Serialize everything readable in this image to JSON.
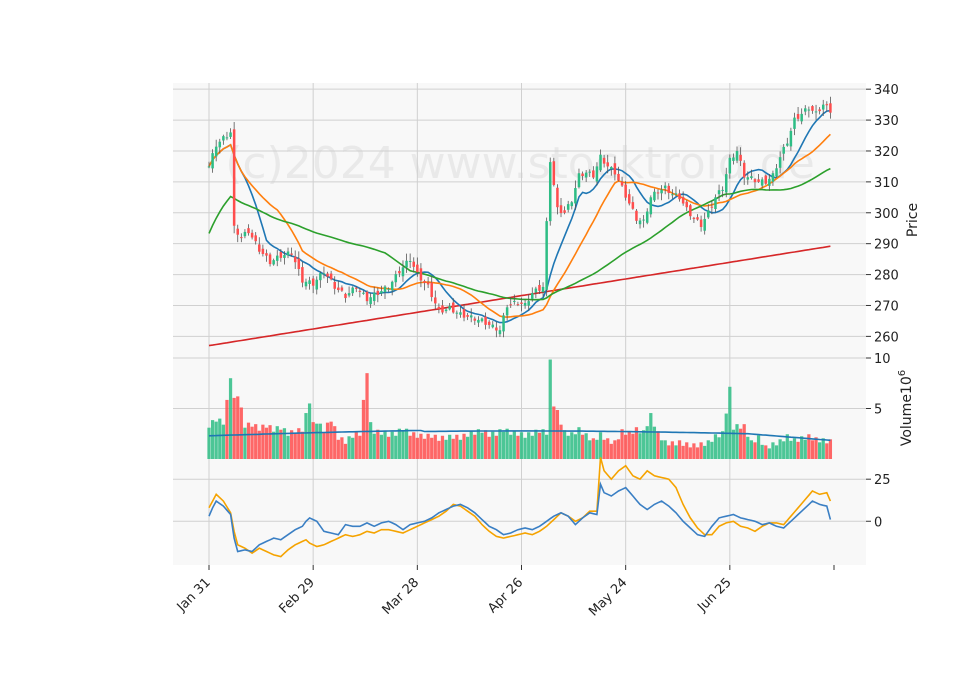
{
  "watermark": "(c)2024 www.stocktroid.de",
  "colors": {
    "up": "#2ebd85",
    "down": "#ff4d4d",
    "ma_short": "#1f77b4",
    "ma_mid": "#ff7f0e",
    "ma_long": "#2ca02c",
    "ma_200": "#d62728",
    "osc_a": "#3a7fc4",
    "osc_b": "#f5a300",
    "panel_bg": "#f8f8f8",
    "grid": "#d0d0d0"
  },
  "chart_data": [
    {
      "type": "candlestick",
      "panel": "price",
      "ylabel": "Price",
      "ylim": [
        253,
        342
      ],
      "yticks": [
        260,
        270,
        280,
        290,
        300,
        310,
        320,
        330,
        340
      ],
      "x_tick_labels": [
        "Jan 31",
        "Feb 29",
        "Mar 28",
        "Apr 26",
        "May 24",
        "Jun 25"
      ],
      "x_tick_index": [
        0,
        29,
        58,
        87,
        116,
        145
      ],
      "x_count": 174,
      "close_anchors": [
        [
          0,
          315
        ],
        [
          2,
          322
        ],
        [
          4,
          324
        ],
        [
          6,
          326
        ],
        [
          7,
          295
        ],
        [
          9,
          292
        ],
        [
          11,
          294
        ],
        [
          14,
          288
        ],
        [
          17,
          284
        ],
        [
          20,
          286
        ],
        [
          23,
          287
        ],
        [
          26,
          278
        ],
        [
          29,
          277
        ],
        [
          32,
          281
        ],
        [
          35,
          276
        ],
        [
          38,
          273
        ],
        [
          41,
          276
        ],
        [
          44,
          272
        ],
        [
          47,
          274
        ],
        [
          50,
          276
        ],
        [
          53,
          281
        ],
        [
          56,
          285
        ],
        [
          58,
          280
        ],
        [
          61,
          276
        ],
        [
          64,
          268
        ],
        [
          67,
          269
        ],
        [
          70,
          267
        ],
        [
          73,
          266
        ],
        [
          76,
          265
        ],
        [
          79,
          263
        ],
        [
          81,
          262
        ],
        [
          83,
          270
        ],
        [
          86,
          271
        ],
        [
          88,
          270
        ],
        [
          90,
          274
        ],
        [
          93,
          276
        ],
        [
          95,
          317
        ],
        [
          97,
          301
        ],
        [
          99,
          300
        ],
        [
          101,
          304
        ],
        [
          103,
          312
        ],
        [
          105,
          313
        ],
        [
          107,
          312
        ],
        [
          109,
          318
        ],
        [
          111,
          315
        ],
        [
          113,
          313
        ],
        [
          115,
          308
        ],
        [
          117,
          303
        ],
        [
          119,
          298
        ],
        [
          121,
          297
        ],
        [
          123,
          305
        ],
        [
          125,
          307
        ],
        [
          127,
          308
        ],
        [
          129,
          306
        ],
        [
          131,
          305
        ],
        [
          133,
          301
        ],
        [
          135,
          298
        ],
        [
          137,
          296
        ],
        [
          139,
          300
        ],
        [
          141,
          305
        ],
        [
          143,
          308
        ],
        [
          145,
          317
        ],
        [
          147,
          320
        ],
        [
          149,
          312
        ],
        [
          151,
          311
        ],
        [
          153,
          310
        ],
        [
          155,
          310
        ],
        [
          157,
          312
        ],
        [
          159,
          318
        ],
        [
          161,
          323
        ],
        [
          163,
          330
        ],
        [
          165,
          332
        ],
        [
          167,
          334
        ],
        [
          169,
          332
        ],
        [
          171,
          335
        ],
        [
          173,
          333
        ]
      ],
      "volume_anchors": [
        [
          0,
          3.3
        ],
        [
          2,
          3.9
        ],
        [
          4,
          3.6
        ],
        [
          5,
          5.6
        ],
        [
          6,
          8.2
        ],
        [
          7,
          5.8
        ],
        [
          8,
          6.4
        ],
        [
          10,
          3.3
        ],
        [
          12,
          3.4
        ],
        [
          14,
          3.0
        ],
        [
          16,
          3.3
        ],
        [
          18,
          2.9
        ],
        [
          20,
          3.1
        ],
        [
          22,
          2.5
        ],
        [
          24,
          2.7
        ],
        [
          26,
          2.9
        ],
        [
          28,
          5.7
        ],
        [
          29,
          3.4
        ],
        [
          30,
          3.7
        ],
        [
          32,
          2.8
        ],
        [
          34,
          3.9
        ],
        [
          36,
          2.1
        ],
        [
          38,
          1.7
        ],
        [
          40,
          2.3
        ],
        [
          42,
          2.5
        ],
        [
          44,
          8.7
        ],
        [
          45,
          3.4
        ],
        [
          46,
          2.7
        ],
        [
          48,
          2.6
        ],
        [
          50,
          2.4
        ],
        [
          52,
          2.5
        ],
        [
          54,
          3.0
        ],
        [
          56,
          2.5
        ],
        [
          58,
          2.3
        ],
        [
          60,
          2.2
        ],
        [
          62,
          2.3
        ],
        [
          64,
          2.0
        ],
        [
          66,
          2.1
        ],
        [
          68,
          2.2
        ],
        [
          70,
          2.1
        ],
        [
          72,
          2.4
        ],
        [
          74,
          2.6
        ],
        [
          76,
          2.8
        ],
        [
          78,
          2.4
        ],
        [
          80,
          2.5
        ],
        [
          82,
          2.9
        ],
        [
          84,
          2.6
        ],
        [
          86,
          2.5
        ],
        [
          88,
          2.3
        ],
        [
          90,
          2.5
        ],
        [
          92,
          2.8
        ],
        [
          94,
          2.6
        ],
        [
          95,
          9.6
        ],
        [
          96,
          5.4
        ],
        [
          97,
          4.6
        ],
        [
          99,
          2.6
        ],
        [
          101,
          2.4
        ],
        [
          103,
          2.9
        ],
        [
          105,
          2.3
        ],
        [
          107,
          1.8
        ],
        [
          109,
          2.4
        ],
        [
          111,
          1.8
        ],
        [
          113,
          1.6
        ],
        [
          115,
          2.7
        ],
        [
          117,
          2.5
        ],
        [
          119,
          2.9
        ],
        [
          121,
          2.6
        ],
        [
          123,
          4.3
        ],
        [
          125,
          2.5
        ],
        [
          127,
          1.6
        ],
        [
          129,
          1.5
        ],
        [
          131,
          1.6
        ],
        [
          133,
          1.4
        ],
        [
          135,
          1.3
        ],
        [
          137,
          1.4
        ],
        [
          139,
          1.6
        ],
        [
          141,
          2.2
        ],
        [
          143,
          2.5
        ],
        [
          145,
          6.9
        ],
        [
          146,
          3.1
        ],
        [
          147,
          3.2
        ],
        [
          149,
          3.2
        ],
        [
          151,
          1.6
        ],
        [
          153,
          2.1
        ],
        [
          155,
          1.1
        ],
        [
          157,
          1.4
        ],
        [
          159,
          1.7
        ],
        [
          161,
          2.2
        ],
        [
          163,
          1.8
        ],
        [
          165,
          2.0
        ],
        [
          167,
          2.2
        ],
        [
          169,
          1.9
        ],
        [
          171,
          1.8
        ],
        [
          173,
          1.7
        ]
      ]
    },
    {
      "type": "bar",
      "panel": "volume",
      "ylabel": "Volume",
      "ylabel_exponent": "10",
      "ylabel_power": "6",
      "ylim": [
        0,
        10
      ],
      "yticks": [
        5,
        10
      ]
    },
    {
      "type": "line",
      "panel": "oscillator",
      "ylim": [
        -26,
        37
      ],
      "yticks": [
        0,
        25
      ],
      "series_a_anchors": [
        [
          0,
          3
        ],
        [
          1,
          8
        ],
        [
          2,
          12
        ],
        [
          4,
          9
        ],
        [
          6,
          4
        ],
        [
          7,
          -10
        ],
        [
          8,
          -18
        ],
        [
          10,
          -17
        ],
        [
          12,
          -18
        ],
        [
          14,
          -14
        ],
        [
          16,
          -12
        ],
        [
          18,
          -10
        ],
        [
          20,
          -11
        ],
        [
          22,
          -8
        ],
        [
          24,
          -5
        ],
        [
          26,
          -3
        ],
        [
          27,
          0
        ],
        [
          28,
          2
        ],
        [
          30,
          0
        ],
        [
          32,
          -6
        ],
        [
          34,
          -7
        ],
        [
          36,
          -8
        ],
        [
          38,
          -2
        ],
        [
          40,
          -3
        ],
        [
          42,
          -3
        ],
        [
          44,
          -1
        ],
        [
          46,
          -3
        ],
        [
          48,
          -1
        ],
        [
          50,
          0
        ],
        [
          52,
          -2
        ],
        [
          54,
          -5
        ],
        [
          56,
          -2
        ],
        [
          58,
          -1
        ],
        [
          60,
          0
        ],
        [
          62,
          2
        ],
        [
          64,
          5
        ],
        [
          66,
          7
        ],
        [
          68,
          9
        ],
        [
          70,
          10
        ],
        [
          72,
          8
        ],
        [
          74,
          5
        ],
        [
          76,
          1
        ],
        [
          78,
          -3
        ],
        [
          80,
          -5
        ],
        [
          82,
          -8
        ],
        [
          84,
          -7
        ],
        [
          86,
          -5
        ],
        [
          88,
          -4
        ],
        [
          90,
          -5
        ],
        [
          92,
          -3
        ],
        [
          94,
          0
        ],
        [
          96,
          3
        ],
        [
          98,
          5
        ],
        [
          100,
          3
        ],
        [
          102,
          -2
        ],
        [
          104,
          2
        ],
        [
          106,
          5
        ],
        [
          108,
          4
        ],
        [
          109,
          22
        ],
        [
          110,
          17
        ],
        [
          112,
          15
        ],
        [
          114,
          18
        ],
        [
          116,
          20
        ],
        [
          118,
          15
        ],
        [
          120,
          10
        ],
        [
          122,
          7
        ],
        [
          124,
          10
        ],
        [
          126,
          12
        ],
        [
          128,
          9
        ],
        [
          130,
          5
        ],
        [
          132,
          0
        ],
        [
          134,
          -4
        ],
        [
          136,
          -8
        ],
        [
          138,
          -9
        ],
        [
          140,
          -3
        ],
        [
          142,
          2
        ],
        [
          144,
          3
        ],
        [
          146,
          4
        ],
        [
          148,
          2
        ],
        [
          150,
          1
        ],
        [
          152,
          0
        ],
        [
          154,
          -2
        ],
        [
          156,
          -1
        ],
        [
          158,
          -3
        ],
        [
          160,
          -4
        ],
        [
          162,
          0
        ],
        [
          164,
          4
        ],
        [
          166,
          8
        ],
        [
          168,
          12
        ],
        [
          170,
          10
        ],
        [
          172,
          9
        ],
        [
          173,
          1
        ]
      ],
      "series_b_anchors": [
        [
          0,
          8
        ],
        [
          1,
          12
        ],
        [
          2,
          16
        ],
        [
          4,
          12
        ],
        [
          6,
          5
        ],
        [
          7,
          -6
        ],
        [
          8,
          -14
        ],
        [
          10,
          -16
        ],
        [
          12,
          -19
        ],
        [
          14,
          -16
        ],
        [
          16,
          -18
        ],
        [
          18,
          -20
        ],
        [
          20,
          -21
        ],
        [
          22,
          -17
        ],
        [
          24,
          -14
        ],
        [
          26,
          -12
        ],
        [
          27,
          -11
        ],
        [
          28,
          -13
        ],
        [
          30,
          -15
        ],
        [
          32,
          -14
        ],
        [
          34,
          -12
        ],
        [
          36,
          -10
        ],
        [
          38,
          -8
        ],
        [
          40,
          -9
        ],
        [
          42,
          -8
        ],
        [
          44,
          -6
        ],
        [
          46,
          -7
        ],
        [
          48,
          -5
        ],
        [
          50,
          -5
        ],
        [
          52,
          -6
        ],
        [
          54,
          -7
        ],
        [
          56,
          -5
        ],
        [
          58,
          -3
        ],
        [
          60,
          -1
        ],
        [
          62,
          1
        ],
        [
          64,
          3
        ],
        [
          66,
          6
        ],
        [
          68,
          10
        ],
        [
          70,
          9
        ],
        [
          72,
          6
        ],
        [
          74,
          3
        ],
        [
          76,
          -2
        ],
        [
          78,
          -6
        ],
        [
          80,
          -9
        ],
        [
          82,
          -10
        ],
        [
          84,
          -9
        ],
        [
          86,
          -8
        ],
        [
          88,
          -7
        ],
        [
          90,
          -8
        ],
        [
          92,
          -6
        ],
        [
          94,
          -3
        ],
        [
          96,
          1
        ],
        [
          98,
          5
        ],
        [
          100,
          3
        ],
        [
          102,
          0
        ],
        [
          104,
          2
        ],
        [
          106,
          6
        ],
        [
          108,
          6
        ],
        [
          109,
          38
        ],
        [
          110,
          30
        ],
        [
          112,
          25
        ],
        [
          114,
          30
        ],
        [
          116,
          33
        ],
        [
          118,
          27
        ],
        [
          120,
          25
        ],
        [
          122,
          30
        ],
        [
          124,
          27
        ],
        [
          126,
          26
        ],
        [
          128,
          25
        ],
        [
          130,
          20
        ],
        [
          132,
          10
        ],
        [
          134,
          2
        ],
        [
          136,
          -4
        ],
        [
          138,
          -8
        ],
        [
          140,
          -8
        ],
        [
          142,
          -3
        ],
        [
          144,
          -1
        ],
        [
          146,
          0
        ],
        [
          148,
          -3
        ],
        [
          150,
          -4
        ],
        [
          152,
          -6
        ],
        [
          154,
          -3
        ],
        [
          156,
          -1
        ],
        [
          158,
          -1
        ],
        [
          160,
          -2
        ],
        [
          162,
          3
        ],
        [
          164,
          8
        ],
        [
          166,
          13
        ],
        [
          168,
          18
        ],
        [
          170,
          16
        ],
        [
          172,
          17
        ],
        [
          173,
          12
        ]
      ]
    }
  ]
}
